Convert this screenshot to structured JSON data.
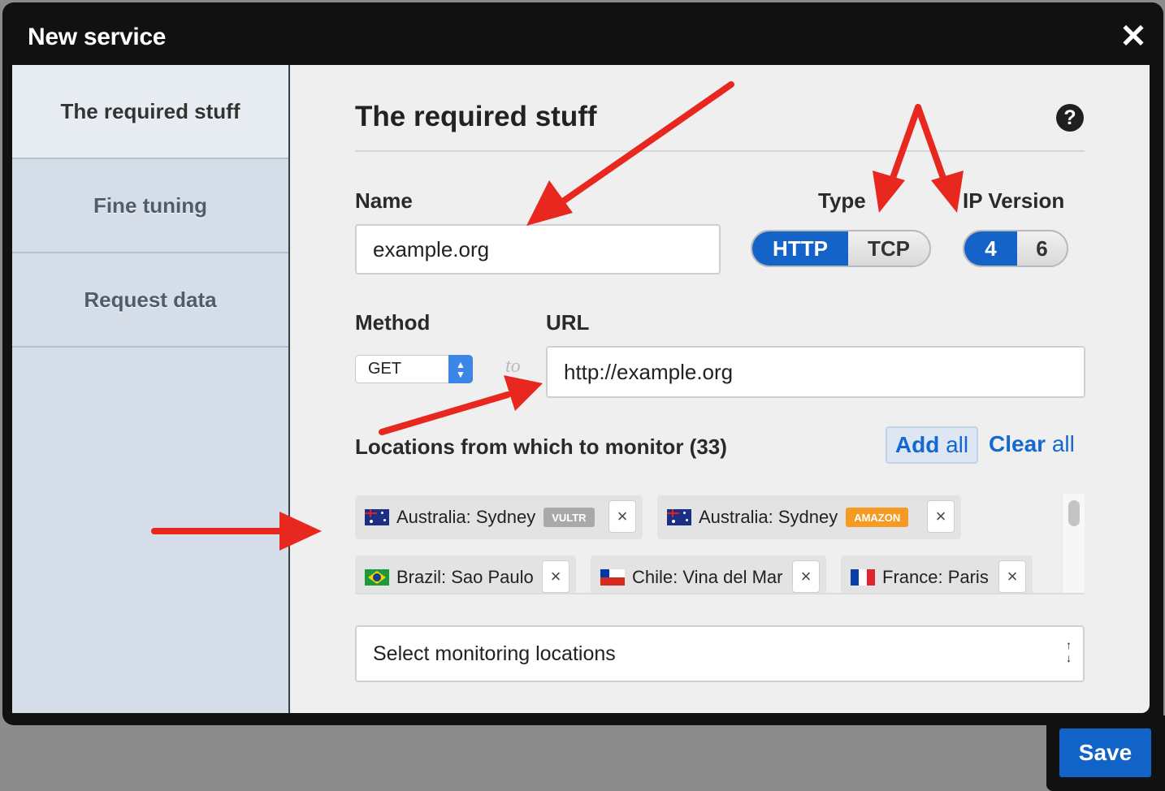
{
  "modal": {
    "title": "New service",
    "close_glyph": "✕"
  },
  "sidebar": {
    "items": [
      {
        "label": "The required stuff",
        "active": true
      },
      {
        "label": "Fine tuning",
        "active": false
      },
      {
        "label": "Request data",
        "active": false
      }
    ]
  },
  "form": {
    "section_title": "The required stuff",
    "help_glyph": "?",
    "name_label": "Name",
    "name_value": "example.org",
    "type_label": "Type",
    "type_options": [
      "HTTP",
      "TCP"
    ],
    "type_selected": "HTTP",
    "ip_label": "IP Version",
    "ip_options": [
      "4",
      "6"
    ],
    "ip_selected": "4",
    "method_label": "Method",
    "method_value": "GET",
    "to_label": "to",
    "url_label": "URL",
    "url_value": "http://example.org",
    "locations_label": "Locations from which to monitor (33)",
    "add_all_main": "Add",
    "add_all_rest": " all",
    "clear_all_main": "Clear",
    "clear_all_rest": " all",
    "locations": [
      {
        "label": "Australia: Sydney",
        "flag": "australia",
        "badge": "VULTR",
        "badge_color": "#a9a9a9"
      },
      {
        "label": "Australia: Sydney",
        "flag": "australia",
        "badge": "AMAZON",
        "badge_color": "#f59a23"
      },
      {
        "label": "Brazil: Sao Paulo",
        "flag": "brazil"
      },
      {
        "label": "Chile: Vina del Mar",
        "flag": "chile"
      },
      {
        "label": "France: Paris",
        "flag": "france"
      }
    ],
    "remove_glyph": "×",
    "location_select_placeholder": "Select monitoring locations",
    "save_label": "Save"
  },
  "colors": {
    "accent": "#1463c9",
    "annotation_arrow": "#e8271f"
  }
}
